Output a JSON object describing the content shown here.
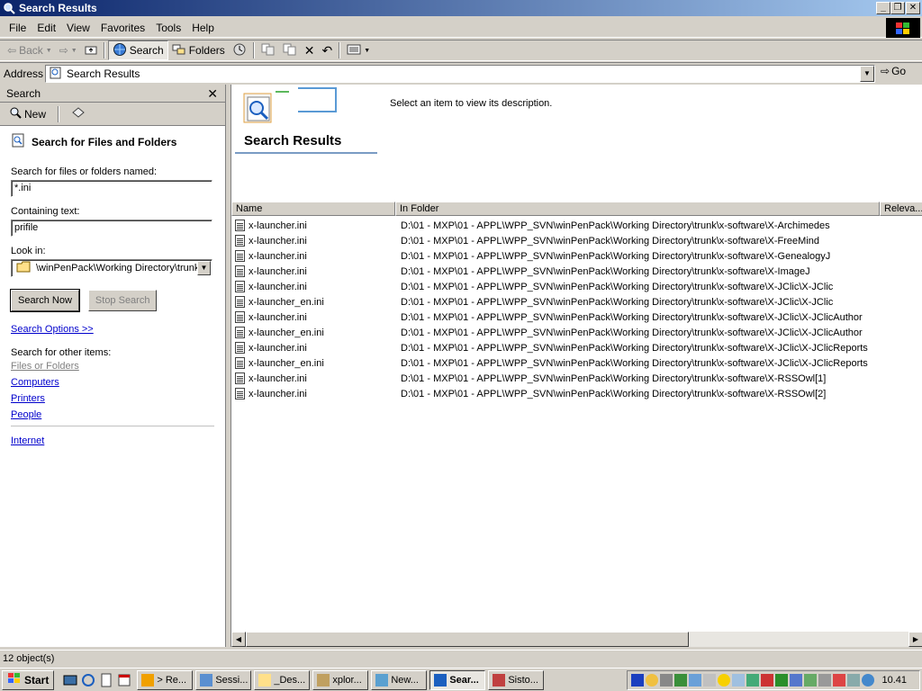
{
  "window": {
    "title": "Search Results"
  },
  "menu": [
    "File",
    "Edit",
    "View",
    "Favorites",
    "Tools",
    "Help"
  ],
  "toolbar": {
    "back": "Back",
    "search": "Search",
    "folders": "Folders"
  },
  "address": {
    "label": "Address",
    "value": "Search Results",
    "go": "Go"
  },
  "search_pane": {
    "header": "Search",
    "new_label": "New",
    "title": "Search for Files and Folders",
    "named_label": "Search for files or folders named:",
    "named_value": "*.ini",
    "containing_label": "Containing text:",
    "containing_value": "prifile",
    "lookin_label": "Look in:",
    "lookin_value": "\\winPenPack\\Working Directory\\trunk",
    "search_now": "Search Now",
    "stop_search": "Stop Search",
    "options_link": "Search Options >>",
    "other_label": "Search for other items:",
    "other_items": [
      "Files or Folders",
      "Computers",
      "Printers",
      "People"
    ],
    "internet": "Internet"
  },
  "results": {
    "banner_title": "Search Results",
    "description": "Select an item to view its description.",
    "columns": [
      "Name",
      "In Folder",
      "Releva..."
    ],
    "rows": [
      {
        "name": "x-launcher.ini",
        "folder": "D:\\01 - MXP\\01 - APPL\\WPP_SVN\\winPenPack\\Working Directory\\trunk\\x-software\\X-Archimedes"
      },
      {
        "name": "x-launcher.ini",
        "folder": "D:\\01 - MXP\\01 - APPL\\WPP_SVN\\winPenPack\\Working Directory\\trunk\\x-software\\X-FreeMind"
      },
      {
        "name": "x-launcher.ini",
        "folder": "D:\\01 - MXP\\01 - APPL\\WPP_SVN\\winPenPack\\Working Directory\\trunk\\x-software\\X-GenealogyJ"
      },
      {
        "name": "x-launcher.ini",
        "folder": "D:\\01 - MXP\\01 - APPL\\WPP_SVN\\winPenPack\\Working Directory\\trunk\\x-software\\X-ImageJ"
      },
      {
        "name": "x-launcher.ini",
        "folder": "D:\\01 - MXP\\01 - APPL\\WPP_SVN\\winPenPack\\Working Directory\\trunk\\x-software\\X-JClic\\X-JClic"
      },
      {
        "name": "x-launcher_en.ini",
        "folder": "D:\\01 - MXP\\01 - APPL\\WPP_SVN\\winPenPack\\Working Directory\\trunk\\x-software\\X-JClic\\X-JClic"
      },
      {
        "name": "x-launcher.ini",
        "folder": "D:\\01 - MXP\\01 - APPL\\WPP_SVN\\winPenPack\\Working Directory\\trunk\\x-software\\X-JClic\\X-JClicAuthor"
      },
      {
        "name": "x-launcher_en.ini",
        "folder": "D:\\01 - MXP\\01 - APPL\\WPP_SVN\\winPenPack\\Working Directory\\trunk\\x-software\\X-JClic\\X-JClicAuthor"
      },
      {
        "name": "x-launcher.ini",
        "folder": "D:\\01 - MXP\\01 - APPL\\WPP_SVN\\winPenPack\\Working Directory\\trunk\\x-software\\X-JClic\\X-JClicReports"
      },
      {
        "name": "x-launcher_en.ini",
        "folder": "D:\\01 - MXP\\01 - APPL\\WPP_SVN\\winPenPack\\Working Directory\\trunk\\x-software\\X-JClic\\X-JClicReports"
      },
      {
        "name": "x-launcher.ini",
        "folder": "D:\\01 - MXP\\01 - APPL\\WPP_SVN\\winPenPack\\Working Directory\\trunk\\x-software\\X-RSSOwl[1]"
      },
      {
        "name": "x-launcher.ini",
        "folder": "D:\\01 - MXP\\01 - APPL\\WPP_SVN\\winPenPack\\Working Directory\\trunk\\x-software\\X-RSSOwl[2]"
      }
    ]
  },
  "status": {
    "count": "12 object(s)"
  },
  "taskbar": {
    "start": "Start",
    "tasks": [
      "> Re...",
      "Sessi...",
      "_Des...",
      "xplor...",
      "New...",
      "Sear...",
      "Sisto..."
    ],
    "active_index": 5,
    "clock": "10.41"
  }
}
